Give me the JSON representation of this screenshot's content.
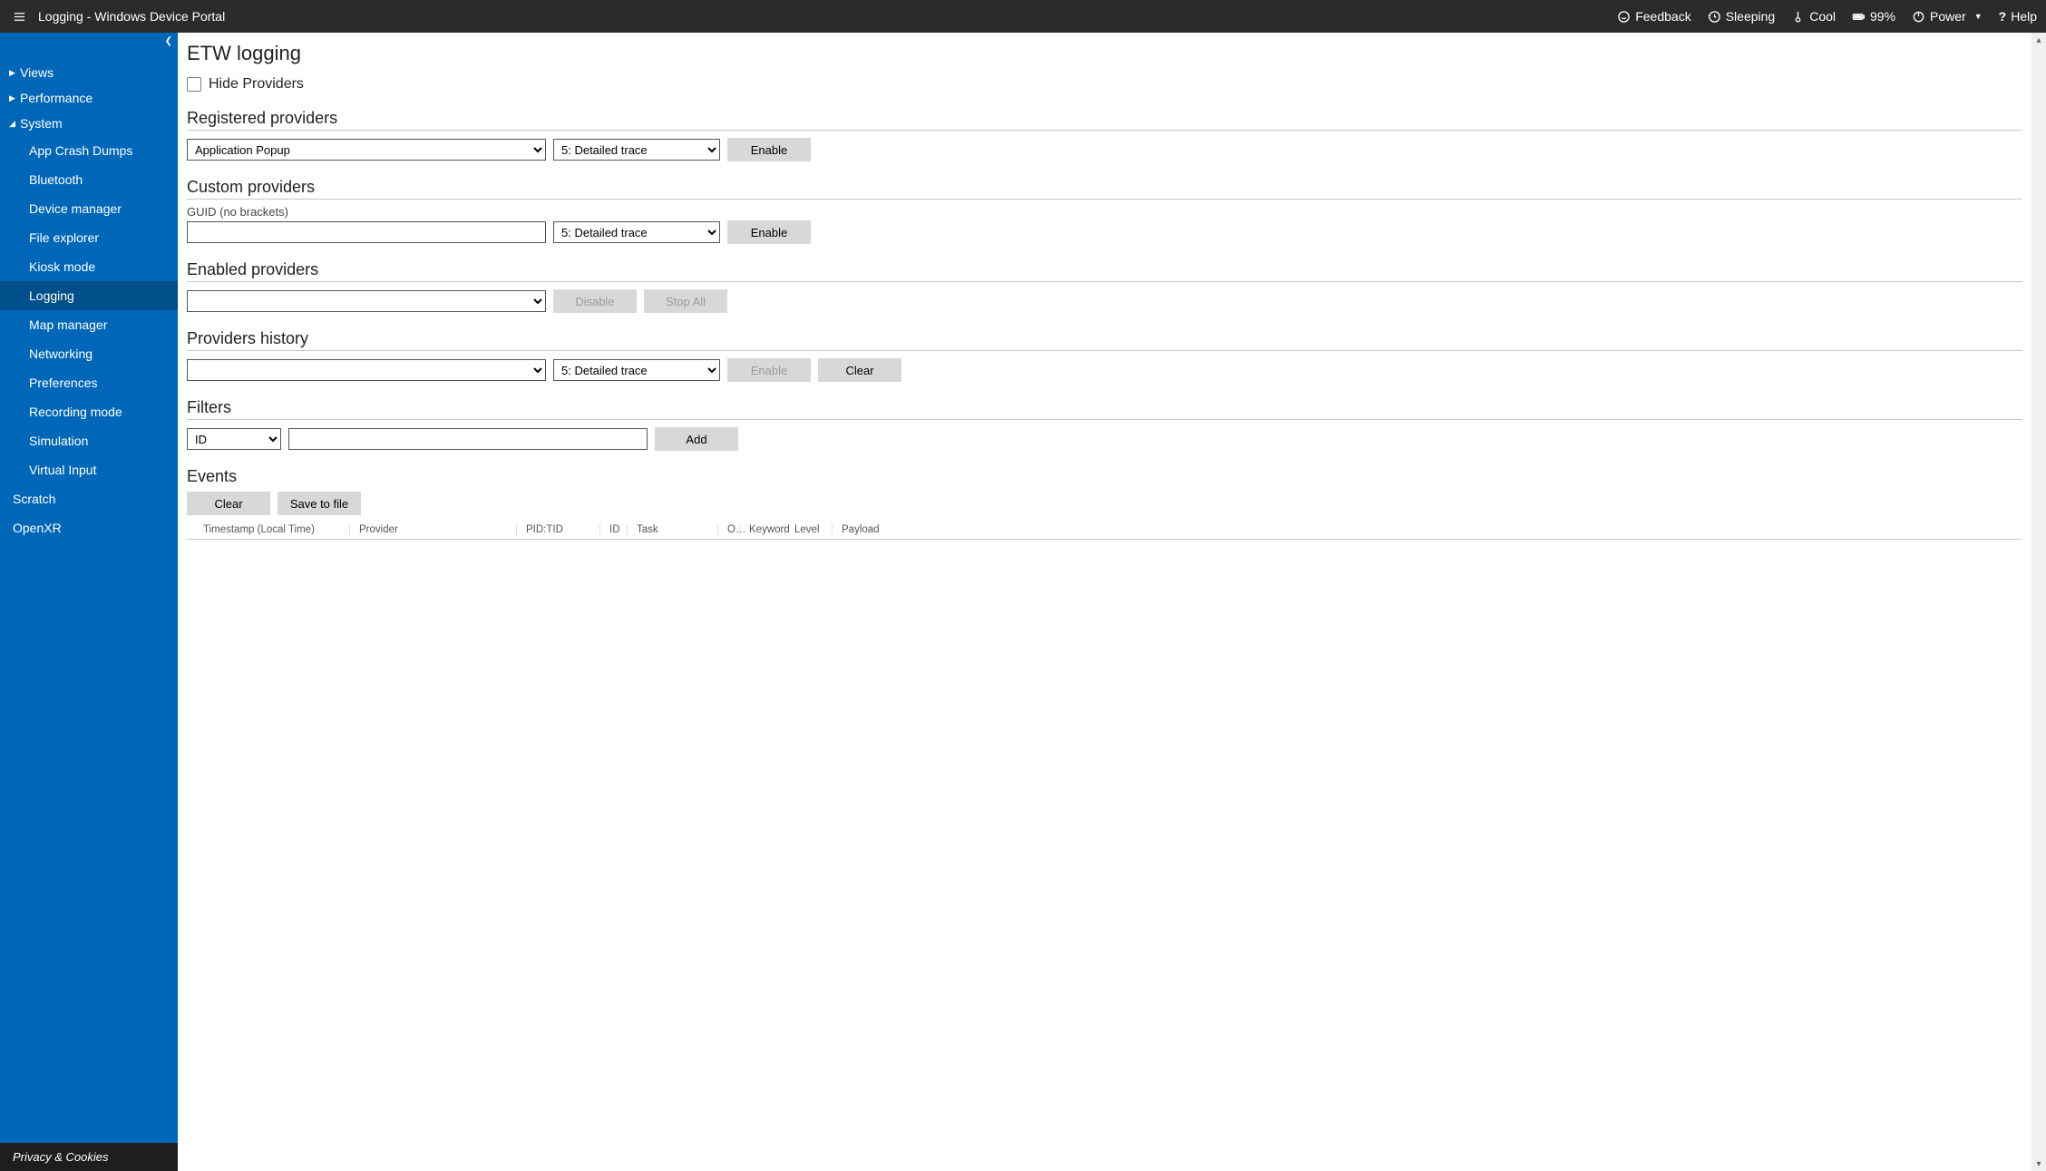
{
  "topbar": {
    "title": "Logging - Windows Device Portal",
    "feedback": "Feedback",
    "sleep": "Sleeping",
    "temp": "Cool",
    "battery": "99%",
    "power": "Power",
    "help": "Help"
  },
  "sidebar": {
    "views_label": "Views",
    "performance_label": "Performance",
    "system_label": "System",
    "system_items": [
      {
        "label": "App Crash Dumps"
      },
      {
        "label": "Bluetooth"
      },
      {
        "label": "Device manager"
      },
      {
        "label": "File explorer"
      },
      {
        "label": "Kiosk mode"
      },
      {
        "label": "Logging"
      },
      {
        "label": "Map manager"
      },
      {
        "label": "Networking"
      },
      {
        "label": "Preferences"
      },
      {
        "label": "Recording mode"
      },
      {
        "label": "Simulation"
      },
      {
        "label": "Virtual Input"
      }
    ],
    "scratch_label": "Scratch",
    "openxr_label": "OpenXR",
    "privacy_label": "Privacy & Cookies"
  },
  "main": {
    "heading": "ETW logging",
    "hide_providers_label": "Hide Providers",
    "sections": {
      "registered": {
        "title": "Registered providers",
        "provider_selected": "Application Popup",
        "level_selected": "5: Detailed trace",
        "enable_label": "Enable"
      },
      "custom": {
        "title": "Custom providers",
        "guid_label": "GUID (no brackets)",
        "guid_value": "",
        "level_selected": "5: Detailed trace",
        "enable_label": "Enable"
      },
      "enabled": {
        "title": "Enabled providers",
        "selected": "",
        "disable_label": "Disable",
        "stop_all_label": "Stop All"
      },
      "history": {
        "title": "Providers history",
        "selected": "",
        "level_selected": "5: Detailed trace",
        "enable_label": "Enable",
        "clear_label": "Clear"
      },
      "filters": {
        "title": "Filters",
        "field_selected": "ID",
        "value": "",
        "add_label": "Add"
      },
      "events": {
        "title": "Events",
        "clear_label": "Clear",
        "save_label": "Save to file",
        "columns": {
          "timestamp": "Timestamp (Local Time)",
          "provider": "Provider",
          "pidtid": "PID:TID",
          "id": "ID",
          "task": "Task",
          "opcode": "O…",
          "keyword": "Keyword",
          "level": "Level",
          "payload": "Payload"
        }
      }
    }
  }
}
